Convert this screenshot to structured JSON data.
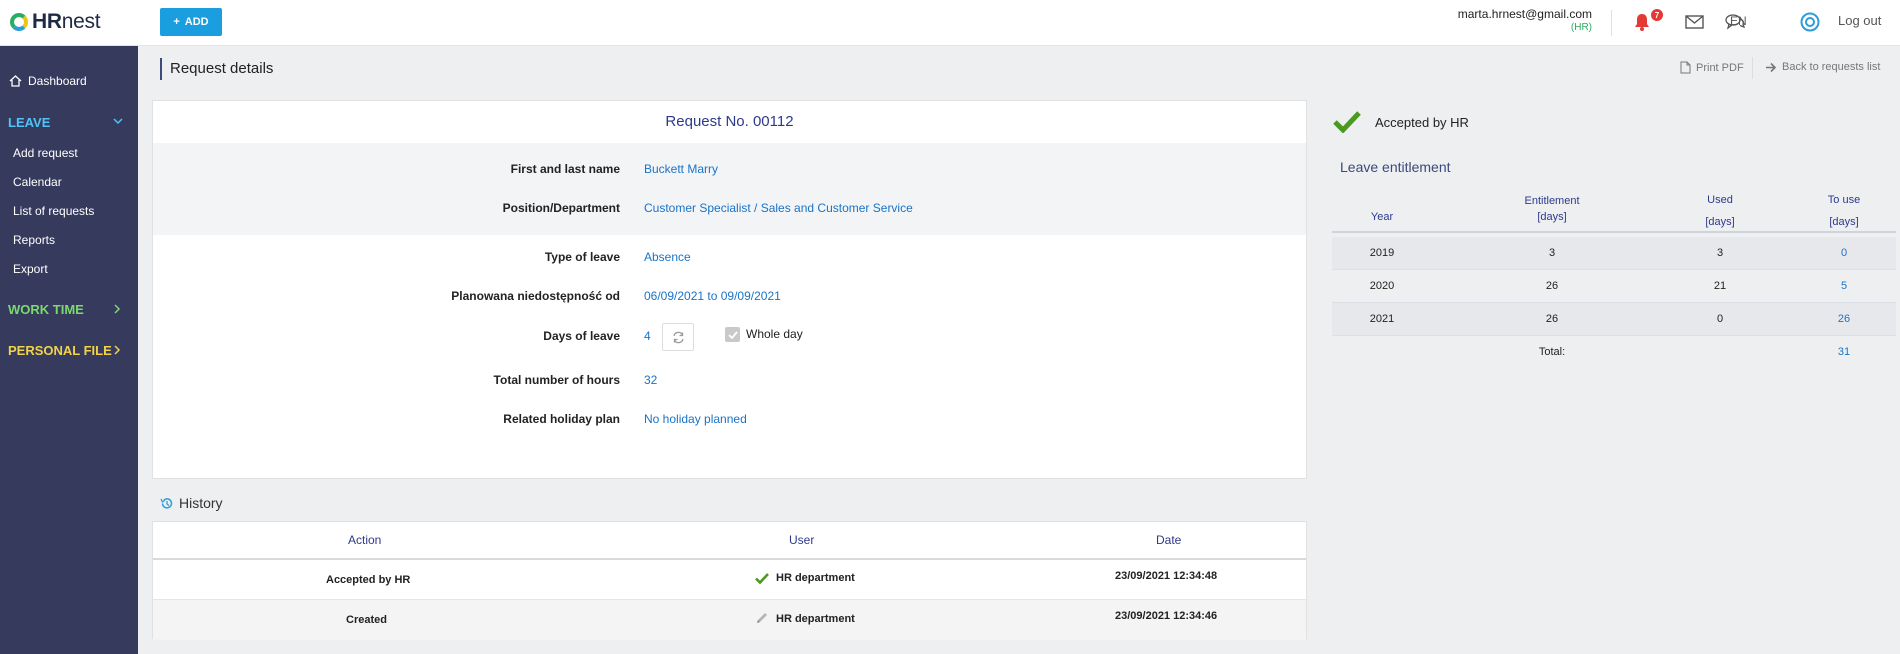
{
  "brand": {
    "logo_bold": "HR",
    "logo_light": "nest"
  },
  "header": {
    "add_label": "ADD",
    "user_email": "marta.hrnest@gmail.com",
    "user_role": "(HR)",
    "notification_count": "7",
    "language": "EN",
    "logout_label": "Log out"
  },
  "sidebar": {
    "dashboard": "Dashboard",
    "leave_group": "LEAVE",
    "leave_items": [
      "Add request",
      "Calendar",
      "List of requests",
      "Reports",
      "Export"
    ],
    "work_time_group": "WORK TIME",
    "personal_file_group": "PERSONAL FILE",
    "colors": {
      "leave": "#4fc3f7",
      "work_time": "#7bd96f",
      "personal_file": "#f2d24b"
    }
  },
  "page": {
    "title": "Request details",
    "print_pdf": "Print PDF",
    "back_link": "Back to requests list"
  },
  "request": {
    "title": "Request No. 00112",
    "fields": [
      {
        "label": "First and last name",
        "value": "Buckett Marry"
      },
      {
        "label": "Position/Department",
        "value": "Customer Specialist / Sales and Customer Service"
      },
      {
        "label": "Type of leave",
        "value": "Absence"
      },
      {
        "label": "Planowana niedostępność od",
        "value": "06/09/2021 to 09/09/2021"
      },
      {
        "label": "Days of leave",
        "value": "4"
      },
      {
        "label": "Total number of hours",
        "value": "32"
      },
      {
        "label": "Related holiday plan",
        "value": "No holiday planned"
      }
    ],
    "whole_day_label": "Whole day",
    "whole_day_checked": true
  },
  "history": {
    "title": "History",
    "columns": [
      "Action",
      "User",
      "Date"
    ],
    "rows": [
      {
        "action": "Accepted by HR",
        "user_icon": "check-icon",
        "user": "HR department",
        "date": "23/09/2021 12:34:48"
      },
      {
        "action": "Created",
        "user_icon": "pencil-icon",
        "user": "HR department",
        "date": "23/09/2021 12:34:46"
      }
    ]
  },
  "status": {
    "label": "Accepted by HR",
    "icon": "check-icon",
    "color": "#4a9a1f"
  },
  "entitlement": {
    "title": "Leave entitlement",
    "columns": {
      "year": "Year",
      "entitlement": "Entitlement",
      "entitlement_unit": "[days]",
      "used": "Used",
      "used_unit": "[days]",
      "to_use": "To use",
      "to_use_unit": "[days]"
    },
    "rows": [
      {
        "year": "2019",
        "entitlement": "3",
        "used": "3",
        "to_use": "0"
      },
      {
        "year": "2020",
        "entitlement": "26",
        "used": "21",
        "to_use": "5"
      },
      {
        "year": "2021",
        "entitlement": "26",
        "used": "0",
        "to_use": "26"
      }
    ],
    "total_label": "Total:",
    "total_value": "31"
  }
}
